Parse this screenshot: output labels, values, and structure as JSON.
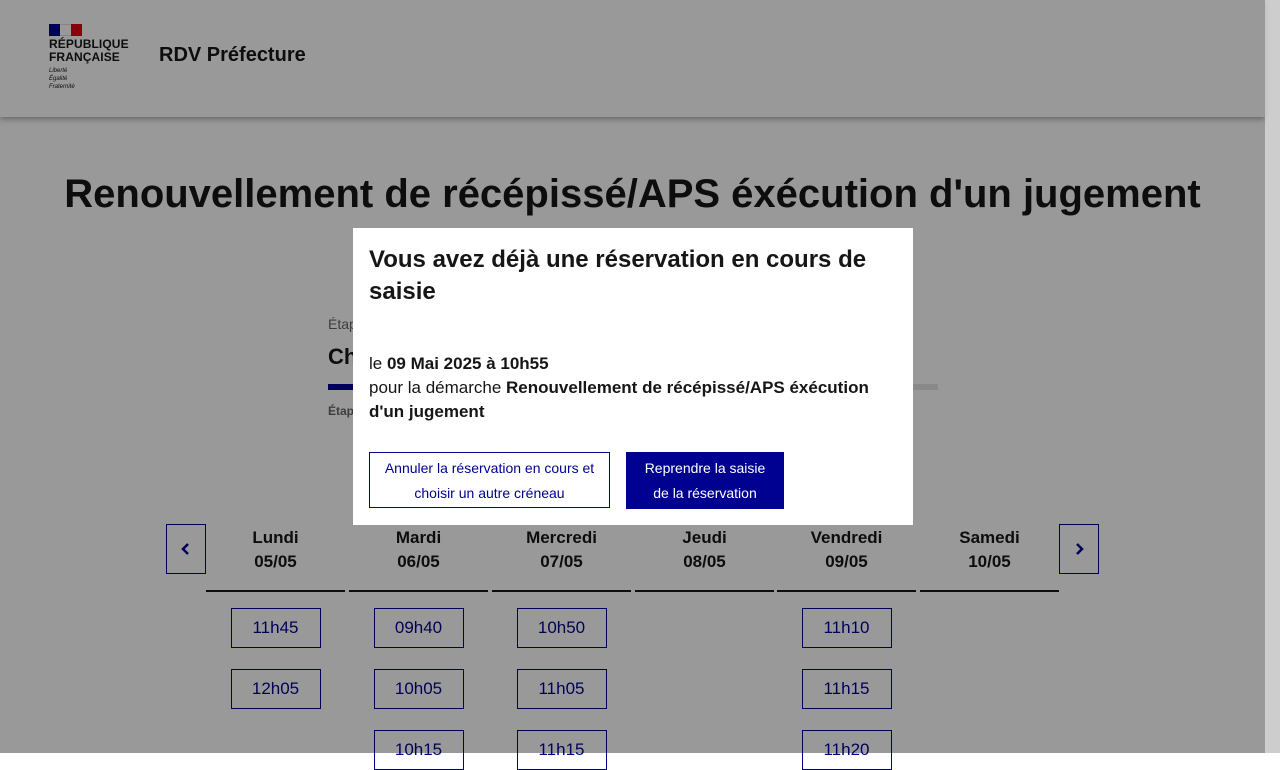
{
  "header": {
    "logo_line1": "RÉPUBLIQUE",
    "logo_line2": "FRANÇAISE",
    "motto": [
      "Liberté",
      "Égalité",
      "Fraternité"
    ],
    "service_title": "RDV Préfecture",
    "flag_colors": [
      "#000091",
      "#ffffff",
      "#e1000f"
    ]
  },
  "main": {
    "title": "Renouvellement de récépissé/APS éxécution d'un jugement",
    "stepper": {
      "label": "Étap",
      "title": "Ch",
      "next": "Étap"
    }
  },
  "calendar": {
    "prev_icon": "chevron-left-icon",
    "next_icon": "chevron-right-icon",
    "days": [
      {
        "name": "Lundi",
        "date": "05/05",
        "slots": [
          "11h45",
          "12h05"
        ]
      },
      {
        "name": "Mardi",
        "date": "06/05",
        "slots": [
          "09h40",
          "10h05",
          "10h15"
        ]
      },
      {
        "name": "Mercredi",
        "date": "07/05",
        "slots": [
          "10h50",
          "11h05",
          "11h15"
        ]
      },
      {
        "name": "Jeudi",
        "date": "08/05",
        "slots": []
      },
      {
        "name": "Vendredi",
        "date": "09/05",
        "slots": [
          "11h10",
          "11h15",
          "11h20"
        ]
      },
      {
        "name": "Samedi",
        "date": "10/05",
        "slots": []
      }
    ]
  },
  "modal": {
    "title": "Vous avez déjà une réservation en cours de saisie",
    "date_prefix": "le ",
    "date_value": "09 Mai 2025 à 10h55",
    "procedure_prefix": "pour la démarche ",
    "procedure_value": "Renouvellement de récépissé/APS éxécution d'un jugement",
    "cancel_label": "Annuler la réservation en cours et choisir un autre créneau",
    "resume_label": "Reprendre la saisie de la réservation"
  },
  "colors": {
    "primary": "#000091",
    "overlay": "rgba(0,0,0,0.40)"
  }
}
